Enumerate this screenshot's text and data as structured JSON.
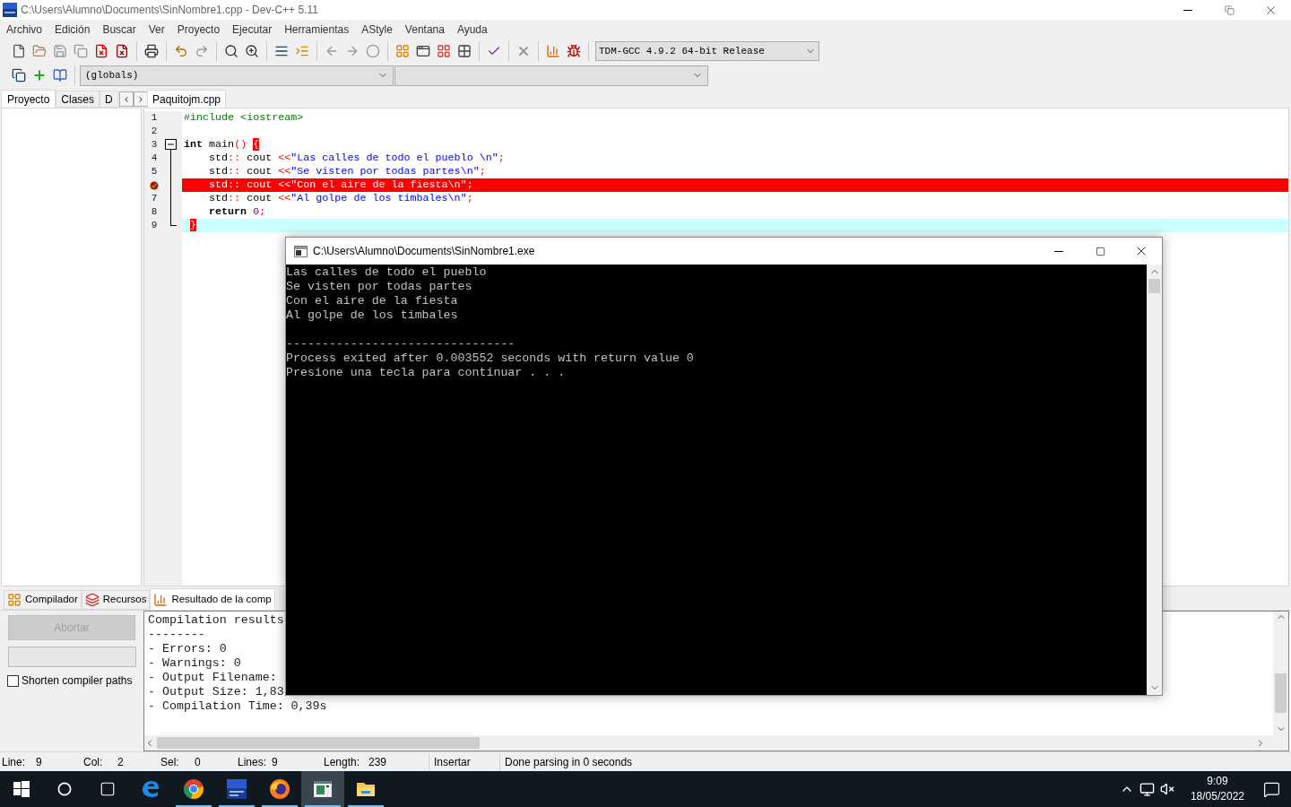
{
  "window": {
    "title": "C:\\Users\\Alumno\\Documents\\SinNombre1.cpp - Dev-C++ 5.11"
  },
  "menu": [
    "Archivo",
    "Edición",
    "Buscar",
    "Ver",
    "Proyecto",
    "Ejecutar",
    "Herramientas",
    "AStyle",
    "Ventana",
    "Ayuda"
  ],
  "compiler_select": {
    "value": "TDM-GCC 4.9.2 64-bit Release"
  },
  "scope_select": {
    "value": "(globals)"
  },
  "left_tabs": [
    {
      "label": "Proyecto",
      "selected": true
    },
    {
      "label": "Clases",
      "selected": false
    },
    {
      "label": "D",
      "selected": false
    }
  ],
  "editor_tabs": [
    {
      "label": "Paquitojm.cpp",
      "selected": true
    }
  ],
  "code_lines": [
    {
      "number": "1",
      "breakpoint": false,
      "current": false,
      "fold_start": false,
      "fold_end": false,
      "tokens": [
        {
          "kind": "preprocessor",
          "text": "#include <iostream>"
        }
      ]
    },
    {
      "number": "2",
      "breakpoint": false,
      "current": false,
      "fold_start": false,
      "fold_end": false
    },
    {
      "number": "3",
      "breakpoint": false,
      "current": false,
      "fold_start": true,
      "fold_end": false,
      "tokens": [
        {
          "kind": "keyword",
          "text": "int"
        },
        {
          "kind": "plain",
          "text": " main"
        },
        {
          "kind": "operator",
          "text": "()"
        },
        {
          "kind": "brace",
          "text": "{"
        }
      ]
    },
    {
      "number": "4",
      "breakpoint": false,
      "current": false,
      "fold_start": false,
      "fold_end": false,
      "tokens": [
        {
          "kind": "plain",
          "text": "    std"
        },
        {
          "kind": "operator",
          "text": "::"
        },
        {
          "kind": "plain",
          "text": " cout "
        },
        {
          "kind": "operator",
          "text": "<<"
        },
        {
          "kind": "string",
          "text": "\"Las calles de todo el pueblo \\n\""
        },
        {
          "kind": "operator",
          "text": ";"
        }
      ]
    },
    {
      "number": "5",
      "breakpoint": false,
      "current": false,
      "fold_start": false,
      "fold_end": false,
      "tokens": [
        {
          "kind": "plain",
          "text": "    std"
        },
        {
          "kind": "operator",
          "text": "::"
        },
        {
          "kind": "plain",
          "text": " cout "
        },
        {
          "kind": "operator",
          "text": "<<"
        },
        {
          "kind": "string",
          "text": "\"Se visten por todas partes\\n\""
        },
        {
          "kind": "operator",
          "text": ";"
        }
      ]
    },
    {
      "breakpoint": true,
      "current": false,
      "fold_start": false,
      "fold_end": false,
      "tokens": [
        {
          "kind": "plain",
          "text": "    std"
        },
        {
          "kind": "operator",
          "text": "::"
        },
        {
          "kind": "plain",
          "text": " cout "
        },
        {
          "kind": "operator",
          "text": "<<"
        },
        {
          "kind": "string",
          "text": "\"Con el aire de la fiesta\\n\""
        },
        {
          "kind": "operator",
          "text": ";"
        }
      ]
    },
    {
      "number": "7",
      "breakpoint": false,
      "current": false,
      "fold_start": false,
      "fold_end": false,
      "tokens": [
        {
          "kind": "plain",
          "text": "    std"
        },
        {
          "kind": "operator",
          "text": "::"
        },
        {
          "kind": "plain",
          "text": " cout "
        },
        {
          "kind": "operator",
          "text": "<<"
        },
        {
          "kind": "string",
          "text": "\"Al golpe de los timbales\\n\""
        },
        {
          "kind": "operator",
          "text": ";"
        }
      ]
    },
    {
      "number": "8",
      "breakpoint": false,
      "current": false,
      "fold_start": false,
      "fold_end": false,
      "tokens": [
        {
          "kind": "keyword",
          "text": "    return"
        },
        {
          "kind": "number",
          "text": "0"
        },
        {
          "kind": "operator",
          "text": ";"
        }
      ]
    },
    {
      "number": "9",
      "breakpoint": false,
      "current": true,
      "fold_start": false,
      "fold_end": true,
      "tokens": [
        {
          "kind": "brace",
          "text": "}"
        }
      ]
    }
  ],
  "bottom_tabs": [
    {
      "label": "Compilador",
      "selected": false
    },
    {
      "label": "Recursos",
      "selected": false
    },
    {
      "label": "Resultado de la comp",
      "selected": true
    }
  ],
  "abort_button": {
    "label": "Abortar",
    "disabled": true
  },
  "shorten_paths": {
    "label": "Shorten compiler paths",
    "checked": false
  },
  "compile_log": [
    "Compilation results",
    "--------",
    "- Errors: 0",
    "- Warnings: 0",
    "- Output Filename:",
    "- Output Size: 1,83",
    "- Compilation Time: 0,39s"
  ],
  "status_bar": [
    {
      "label": "Line:",
      "value": "9"
    },
    {
      "label": "Col:",
      "value": "2"
    },
    {
      "label": "Sel:",
      "value": "0"
    },
    {
      "label": "Lines:",
      "value": "9"
    },
    {
      "label": "Length:",
      "value": "239"
    }
  ],
  "insert_mode": "Insertar",
  "parse_status": "Done parsing in 0 seconds",
  "console": {
    "title": "C:\\Users\\Alumno\\Documents\\SinNombre1.exe",
    "output": [
      "Las calles de todo el pueblo",
      "Se visten por todas partes",
      "Con el aire de la fiesta",
      "Al golpe de los timbales"
    ],
    "footer": [
      "--------------------------------",
      "Process exited after 0.003552 seconds with return value 0",
      "Presione una tecla para continuar . . ."
    ]
  },
  "taskbar": {
    "apps": [
      {
        "kind": "edge",
        "running": false,
        "active": false
      },
      {
        "kind": "chrome",
        "running": true,
        "active": false
      },
      {
        "kind": "devcpp",
        "running": true,
        "active": false
      },
      {
        "kind": "firefox",
        "running": true,
        "active": false
      },
      {
        "kind": "console",
        "running": true,
        "active": true
      },
      {
        "kind": "explorer",
        "running": true,
        "active": false
      }
    ],
    "time": "9:09",
    "date": "18/05/2022"
  }
}
